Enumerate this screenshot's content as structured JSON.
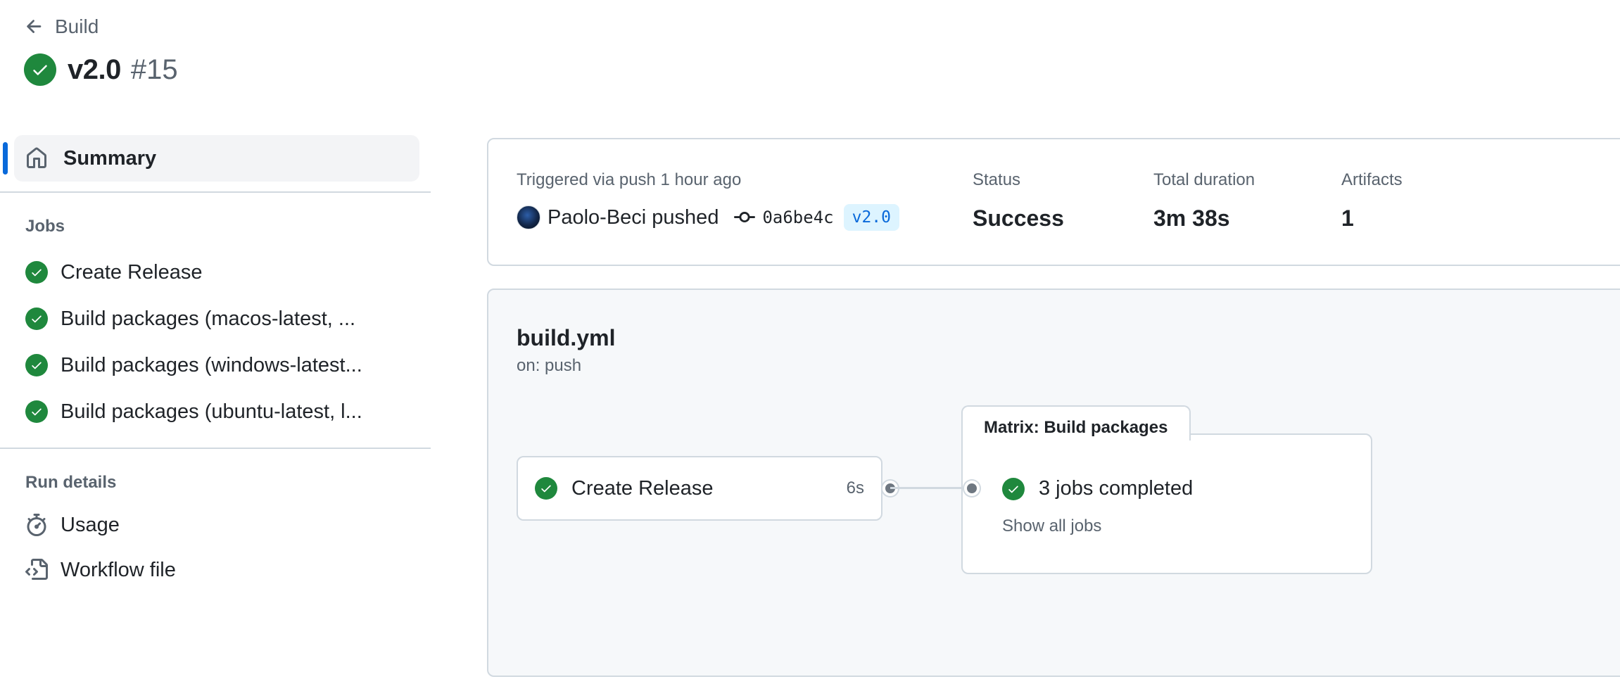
{
  "header": {
    "back_label": "Build",
    "run_name": "v2.0",
    "run_number": "#15"
  },
  "sidebar": {
    "summary_label": "Summary",
    "jobs_heading": "Jobs",
    "jobs": [
      {
        "label": "Create Release",
        "status": "success"
      },
      {
        "label": "Build packages (macos-latest, ...",
        "status": "success"
      },
      {
        "label": "Build packages (windows-latest...",
        "status": "success"
      },
      {
        "label": "Build packages (ubuntu-latest, l...",
        "status": "success"
      }
    ],
    "run_details_heading": "Run details",
    "run_details": [
      {
        "label": "Usage",
        "icon": "stopwatch-icon"
      },
      {
        "label": "Workflow file",
        "icon": "file-code-icon"
      }
    ]
  },
  "summary_card": {
    "trigger_label": "Triggered via push 1 hour ago",
    "pusher_text": "Paolo-Beci pushed",
    "commit_sha": "0a6be4c",
    "tag": "v2.0",
    "status_label": "Status",
    "status_value": "Success",
    "duration_label": "Total duration",
    "duration_value": "3m 38s",
    "artifacts_label": "Artifacts",
    "artifacts_value": "1"
  },
  "workflow": {
    "file_name": "build.yml",
    "trigger": "on: push",
    "job": {
      "name": "Create Release",
      "duration": "6s"
    },
    "matrix": {
      "title": "Matrix: Build packages",
      "summary": "3 jobs completed",
      "link": "Show all jobs"
    }
  },
  "colors": {
    "success": "#1f883d",
    "accent": "#0969da",
    "muted_text": "#59636e",
    "border": "#d1d9e0"
  }
}
